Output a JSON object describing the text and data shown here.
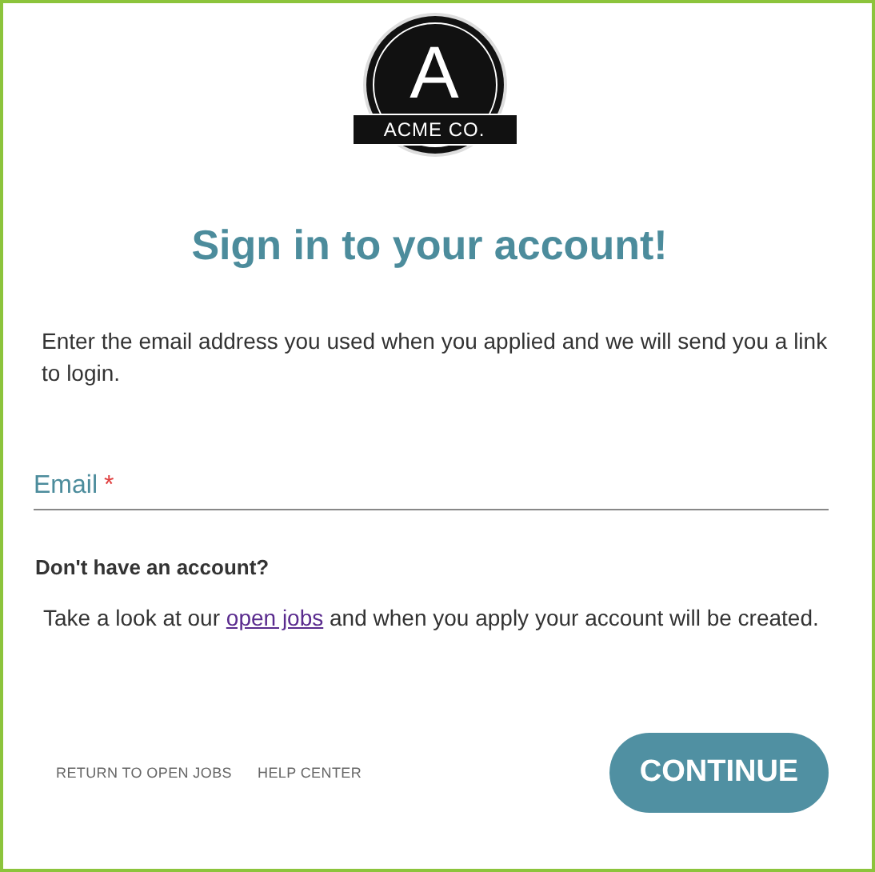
{
  "logo": {
    "letter": "A",
    "name": "ACME CO."
  },
  "heading": "Sign in to your account!",
  "intro": "Enter the email address you used when you applied and we will send you a link to login.",
  "email_field": {
    "label": "Email",
    "required_mark": "*",
    "required": true
  },
  "signup": {
    "title": "Don't have an account?",
    "text_before": "Take a look at our ",
    "link": "open jobs",
    "text_after": " and when you apply your account will be created."
  },
  "footer_links": [
    "RETURN TO OPEN JOBS",
    "HELP CENTER"
  ],
  "button": "CONTINUE"
}
